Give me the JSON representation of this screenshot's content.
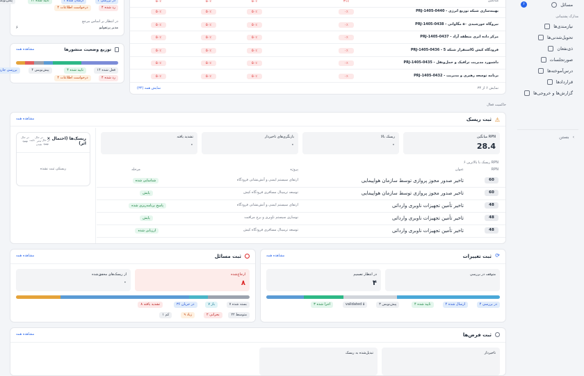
{
  "sidebar": {
    "issues_label": "مسائل",
    "issues_count": "۶",
    "section_title": "مدارک پشتیبانی",
    "items": [
      "نیازمندی‌ها",
      "تحویل‌شدنی‌ها",
      "ذی‌نفعان",
      "صورتجلسات",
      "درس‌آموخته‌ها",
      "قراردادها",
      "گزارش‌ها و خروجی‌ها"
    ],
    "close_label": "بستن"
  },
  "top_left": {
    "pills_top": [
      "در بررسی ۴",
      "ارسال شده ۴",
      "تایید شده ۱۴",
      "پیش‌نویس ۳"
    ],
    "pills_sub": [
      "رد شده ۴",
      "درخواست اطلاعات ۴"
    ],
    "ref_label": "در انتظار بر اساس مرجع",
    "ref_value": "مدیر پرتفولیو",
    "ref_count": "۶"
  },
  "pub_card": {
    "title": "توزیع وضعیت منشورها",
    "see_all": "مشاهده همه",
    "pills": [
      "فعل شده ۱۴",
      "تایید شده ۴",
      "پیش‌نویس ۴",
      "بررسی جاری ۴"
    ],
    "pills_sub": [
      "رد شده ۴",
      "درخواست اطلاعات ۴"
    ]
  },
  "projects": {
    "header_row": {
      "name": "میانگین",
      "c1": "۴۱٪",
      "c2": "۵۰٪",
      "c3": "۵۰٪",
      "c4": "۵۰٪"
    },
    "rows": [
      {
        "name": "PRJ-1405-0440 - بهینه‌سازی شبکه توزیع انرژی",
        "c1": "۰٪",
        "c2": "۵۰٪",
        "c3": "۵۰٪",
        "c4": "۵۰٪"
      },
      {
        "name": "PRJ-1405-0438 - نیروگاه خورشیدی ۵۰ مگاواتی",
        "c1": "۰٪",
        "c2": "۵۰٪",
        "c3": "۵۰٪",
        "c4": "۵۰٪"
      },
      {
        "name": "PRJ-1405-0437 - مرکز داده ابری منطقه آزاد",
        "c1": "۰٪",
        "c2": "۵۰٪",
        "c3": "۵۰٪",
        "c4": "۵۰٪"
      },
      {
        "name": "PRJ-1405-0436 - استقرار شبکه 5G فرودگاه کیش",
        "c1": "۰٪",
        "c2": "۵۰٪",
        "c3": "۵۰٪",
        "c4": "۵۰٪"
      },
      {
        "name": "PRJ-1405-0435 - داشبورد مدیریت ترافیک و حمل‌ونقل",
        "c1": "۰٪",
        "c2": "۵۰٪",
        "c3": "۵۰٪",
        "c4": "۵۰٪"
      },
      {
        "name": "PRJ-1405-0432 - برنامه توسعه رهبری و مدیریت",
        "c1": "۰٪",
        "c2": "۵۰٪",
        "c3": "۵۰٪",
        "c4": "۵۰٪"
      }
    ],
    "footer_count": "نمایش ۶ از ۳۴",
    "footer_link": "نمایش همه (۳۴)"
  },
  "governance_label": "حاکمیت فعال",
  "risk": {
    "title": "ثبت ریسک",
    "see_all": "مشاهده همه",
    "stats": [
      {
        "label": "میانگین RPN",
        "value": "28.4"
      },
      {
        "label": "ریسک بالا",
        "value": "۰"
      },
      {
        "label": "بازنگری‌های تاخیردار",
        "value": "۰"
      },
      {
        "label": "تشدید یافته",
        "value": "۰"
      }
    ],
    "top_label": "۶ ریسک با بالاترین RPN",
    "headers": {
      "rpn": "RPN",
      "title": "عنوان",
      "project": "پروژه",
      "stage": "مرحله"
    },
    "rows": [
      {
        "rpn": "60",
        "title": "تاخیر صدور مجوز پروازی توسط سازمان هواپیمایی",
        "project": "ارتقای سیستم ایمنی و آتش‌نشانی فرودگاه",
        "stage": "شناسایی شده"
      },
      {
        "rpn": "60",
        "title": "تاخیر صدور مجوز پروازی توسط سازمان هواپیمایی",
        "project": "توسعه ترمینال مسافری فرودگاه کیش",
        "stage": "پایش"
      },
      {
        "rpn": "48",
        "title": "تاخیر تأمین تجهیزات ناوبری وارداتی",
        "project": "ارتقای سیستم ایمنی و آتش‌نشانی فرودگاه",
        "stage": "پاسخ برنامه‌ریزی شده"
      },
      {
        "rpn": "48",
        "title": "تاخیر تأمین تجهیزات ناوبری وارداتی",
        "project": "نوسازی سیستم ناوبری و برج مراقبت",
        "stage": "پایش"
      },
      {
        "rpn": "48",
        "title": "تاخیر تأمین تجهیزات ناوبری وارداتی",
        "project": "توسعه ترمینال مسافری فرودگاه کیش",
        "stage": "ارزیابی شده"
      }
    ],
    "matrix_title": "ریسک‌ها (احتمال × اثر)",
    "matrix_legend": [
      "در حال بهبود",
      "ثابت",
      "در حال بدتر شدن",
      "در حال بهبود"
    ],
    "matrix_empty": "ریسکی ثبت نشده"
  },
  "changes": {
    "title": "ثبت تغییرات",
    "see_all": "مشاهده همه",
    "stat1_label": "متوقف در بررسی",
    "stat1_value": "",
    "stat2_label": "در انتظار تصمیم",
    "stat2_value": "۴",
    "pills": [
      "در بررسی ۴",
      "ارسال شده ۴",
      "تایید شده ۴",
      "پیش‌نویس ۳",
      "validated ۵",
      "اجرا شده ۳"
    ]
  },
  "issues": {
    "title": "ثبت مسائل",
    "see_all": "مشاهده همه",
    "stat1_label": "ارجاع‌شده",
    "stat1_value": "۸",
    "stat2_label": "از ریسک‌های محقق‌شده",
    "stat2_value": "۰",
    "pills": [
      "بسته شده ۷",
      "باز ۷",
      "در جریان ۳۶",
      "تشدید یافته ۸"
    ],
    "pills2": [
      "متوسط ۲۲",
      "بحرانی ۲",
      "زیاد ۹",
      "کم ۱"
    ]
  },
  "assumptions": {
    "title": "ثبت فرض‌ها",
    "see_all": "مشاهده همه",
    "stat1_label": "تاخیردار",
    "stat2_label": "تبدیل‌شده به ریسک"
  }
}
